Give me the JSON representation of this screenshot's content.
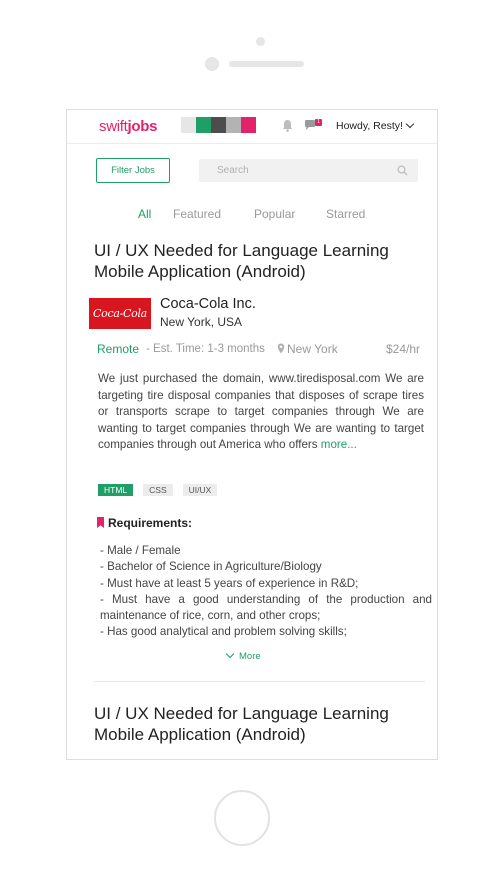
{
  "header": {
    "logo_part1": "swift",
    "logo_part2": "jobs",
    "swatch_colors": [
      "#e6e6e6",
      "#1f9e67",
      "#4d4d4d",
      "#b3b3b3",
      "#e3226c"
    ],
    "notification_icon": "bell-icon",
    "messages_icon": "chat-icon",
    "messages_count": "1",
    "user_menu_label": "Howdy, Resty!"
  },
  "toolbar": {
    "filter_label": "Filter Jobs",
    "search_placeholder": "Search"
  },
  "tabs": [
    {
      "label": "All",
      "active": true
    },
    {
      "label": "Featured",
      "active": false
    },
    {
      "label": "Popular",
      "active": false
    },
    {
      "label": "Starred",
      "active": false
    }
  ],
  "jobs": [
    {
      "title_line1": "UI / UX Needed for Language Learning",
      "title_line2": "Mobile Application (Android)",
      "company_logo_text": "Coca-Cola",
      "company_name": "Coca-Cola Inc.",
      "company_location": "New York, USA",
      "work_type": "Remote",
      "est_time": "- Est. Time: 1-3 months",
      "place": "New York",
      "rate": "$24/hr",
      "description": "We just purchased the domain, www.tiredisposal.com We are targeting tire disposal companies that disposes of scrape tires or transports scrape to target companies through We are wanting to target companies through We are wanting to target companies through out America who offers",
      "more_label": "more...",
      "tags": [
        "HTML",
        "CSS",
        "UI/UX"
      ],
      "requirements_heading": "Requirements:",
      "requirements": [
        "-  Male / Female",
        "- Bachelor of Science in Agriculture/Biology",
        "- Must have at least 5 years of experience in R&D;",
        "- Must have a good understanding of the production and maintenance of rice, corn,  and other crops;",
        "- Has good analytical and problem solving skills;"
      ],
      "more_toggle_label": "More"
    },
    {
      "title_line1": "UI / UX Needed for Language Learning",
      "title_line2": "Mobile Application (Android)"
    }
  ],
  "colors": {
    "brand": "#e3226c",
    "accent": "#1f9e67",
    "muted": "#999999"
  }
}
